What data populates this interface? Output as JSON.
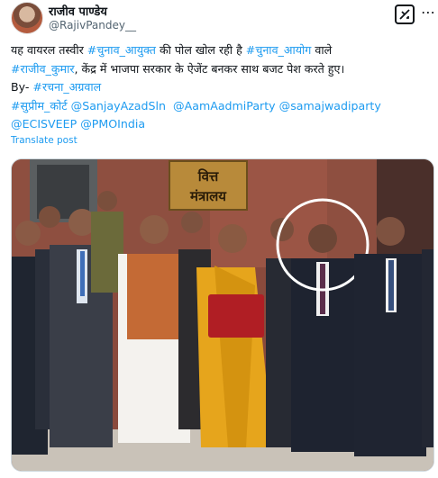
{
  "author": {
    "name": "राजीव पाण्डेय",
    "handle": "@RajivPandey__"
  },
  "icons": {
    "grok": "grok-icon",
    "more": "more-icon"
  },
  "post": {
    "line1": {
      "t1": "यह वायरल तस्वीर ",
      "h1": "#चुनाव_आयुक्त",
      "t2": " की पोल खोल रही है ",
      "h2": "#चुनाव_आयोग",
      "t3": " वाले"
    },
    "line2": {
      "h1": "#राजीव_कुमार",
      "t1": ", केंद्र में भाजपा सरकार के ऐजेंट बनकर साथ बजट पेश करते हुए।"
    },
    "line3": {
      "t1": "By- ",
      "h1": "#रचना_अग्रवाल"
    },
    "line4": {
      "m1": "#सुप्रीम_कोर्ट",
      "m2": "@SanjayAzadSln",
      "m3": "@AamAadmiParty",
      "m4": "@samajwadiparty"
    },
    "line5": {
      "m1": "@ECISVEEP",
      "m2": "@PMOIndia"
    }
  },
  "translate_label": "Translate post",
  "photo": {
    "sign_line1": "वित्त",
    "sign_line2": "मंत्रालय"
  },
  "colors": {
    "link": "#1d9bf0",
    "text": "#0f1419",
    "secondary": "#536471"
  }
}
